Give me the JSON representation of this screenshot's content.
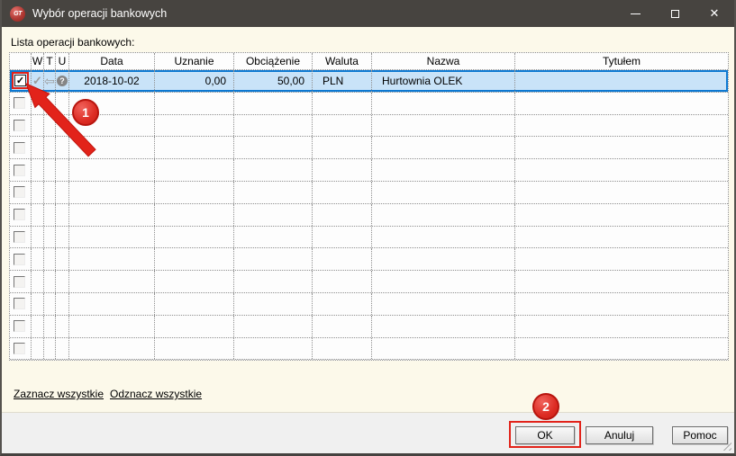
{
  "window": {
    "title": "Wybór operacji bankowych",
    "logo_text": "GT"
  },
  "icons": {
    "close": "✕",
    "check": "✓",
    "arrow_left": "⇦",
    "question": "?"
  },
  "content": {
    "list_label": "Lista operacji bankowych:"
  },
  "table": {
    "columns": [
      "",
      "W",
      "T",
      "U",
      "Data",
      "Uznanie",
      "Obciążenie",
      "Waluta",
      "Nazwa",
      "Tytułem"
    ],
    "rows": [
      {
        "checked": true,
        "data": "2018-10-02",
        "uznanie": "0,00",
        "obciazenie": "50,00",
        "waluta": "PLN",
        "nazwa": "Hurtownia OLEK",
        "tytulem": ""
      }
    ],
    "empty_row_count": 12
  },
  "links": {
    "select_all": "Zaznacz wszystkie",
    "deselect_all": "Odznacz wszystkie"
  },
  "footer": {
    "ok": "OK",
    "cancel": "Anuluj",
    "help": "Pomoc"
  },
  "annotations": {
    "step1": "1",
    "step2": "2"
  },
  "colors": {
    "accent_red": "#e2231a",
    "selection_bg": "#c9e3f8",
    "selection_border": "#0d79d2",
    "titlebar": "#474440",
    "content_bg": "#fcf9ea",
    "footer_bg": "#f0f0f0"
  }
}
